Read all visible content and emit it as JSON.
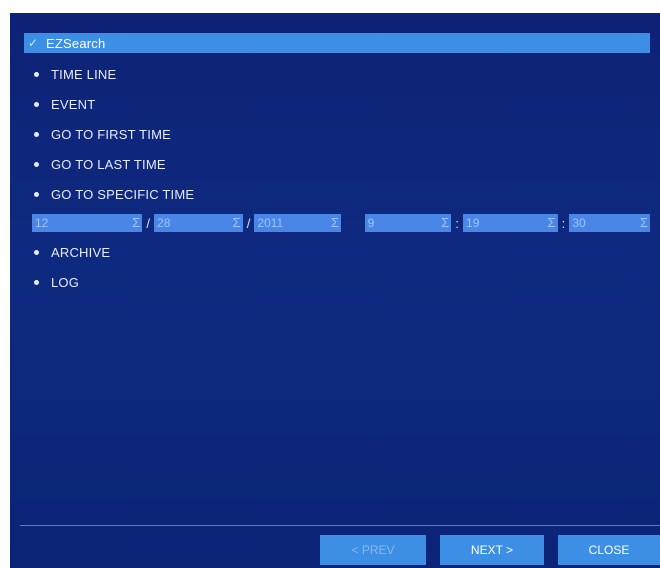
{
  "menu": {
    "items": [
      {
        "label": "EZSearch",
        "selected": true
      },
      {
        "label": "TIME LINE"
      },
      {
        "label": "EVENT"
      },
      {
        "label": "GO TO FIRST TIME"
      },
      {
        "label": "GO TO LAST TIME"
      },
      {
        "label": "GO TO SPECIFIC TIME"
      },
      {
        "label": "ARCHIVE"
      },
      {
        "label": "LOG"
      }
    ]
  },
  "date_time": {
    "month": "12",
    "day": "28",
    "year": "2011",
    "hour": "9",
    "minute": "19",
    "second": "30",
    "date_sep": "/",
    "time_sep": ":",
    "spin_glyph": "Σ"
  },
  "buttons": {
    "prev": "< PREV",
    "next": "NEXT >",
    "close": "CLOSE"
  },
  "colors": {
    "panel_bg": "#0e2a80",
    "highlight": "#3d8fe6",
    "field_bg": "#4a86e8"
  }
}
